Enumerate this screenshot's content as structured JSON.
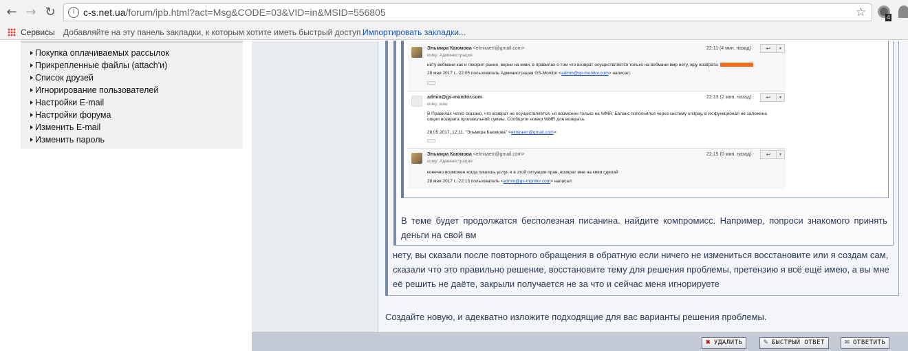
{
  "browser": {
    "url_host": "c-s.net.ua",
    "url_path": "/forum/ipb.html?act=Msg&CODE=03&VID=in&MSID=556805",
    "extension_badge": "4"
  },
  "bookmarks_bar": {
    "apps_label": "Сервисы",
    "hint": "Добавляйте на эту панель закладки, к которым хотите иметь быстрый доступ.",
    "import_link": "Импортировать закладки..."
  },
  "left_menu": {
    "items": [
      "Покупка оплачиваемых рассылок",
      "Прикрепленные файлы (attach'и)",
      "Список друзей",
      "Игнорирование пользователей",
      "Настройки E-mail",
      "Настройки форума",
      "Изменить E-mail",
      "Изменить пароль"
    ]
  },
  "emails": [
    {
      "from_name": "Эльмира Каюмова",
      "from_addr": "<elmiraerr@gmail.com>",
      "to": "кому: Администрация",
      "time": "22:11 (4 мин. назад)",
      "body1": "нету вебмани как и говорил ранее, верни на киви, в правилах о том что возврат осуществляется только на вебмани вмр нету, жду возврата:",
      "body2_prefix": "28 мая 2017 г., 22:05 пользователь Администрация GS-Monitor <",
      "body2_link": "admin@gs-monitor.com",
      "body2_suffix": "> написал:"
    },
    {
      "from_name": "admin@gs-monitor.com",
      "from_addr": "",
      "to": "кому: мне",
      "time": "22:13 (2 мин. назад)",
      "body1": "В Правилах четко сказано, что возврат не осуществляется, но возможен только на WMR. Баланс пополнялся через систему unitpay, в их функционал не заложена",
      "body1b": "опция возврата произвольной суммы. Сообщите номер WMR для возврата.",
      "body2_prefix": "28.05.2017, 12:11, \"Эльмира Каюмова\" <",
      "body2_link": "elmiraerr@gmail.com",
      "body2_suffix": ">:"
    },
    {
      "from_name": "Эльмира Каюмова",
      "from_addr": "<elmiraerr@gmail.com>",
      "to": "кому: Администрация",
      "time": "22:15 (0 мин. назад)",
      "body1": "конечно возможен когда пишешь услуг, я в этой ситуации прав, возврат мне на киви сделай",
      "body2_prefix": "28 мая 2017 г., 22:13 пользователь <",
      "body2_link": "admin@gs-monitor.com",
      "body2_suffix": "> написал:"
    }
  ],
  "quote_text": "В теме будет продолжатся бесполезная писанина. найдите компромисс. Например, попроси знакомого принять деньги на свой вм",
  "post_text": "нету, вы сказали после повторного обращения в обратную если ничего не измениться восстановите или я создам сам, сказали что это правильно решение, восстановите тему для решения проблемы, претензию я всё ещё имею, а вы мне её решить не даёте, закрыли получается не за что и сейчас меня игнорируете",
  "reply_text": "Создайте новую, и адекватно изложите подходящие для вас варианты решения проблемы.",
  "footer_buttons": {
    "delete": "УДАЛИТЬ",
    "quick_reply": "БЫСТРЫЙ ОТВЕТ",
    "reply": "ОТВЕТИТЬ"
  }
}
